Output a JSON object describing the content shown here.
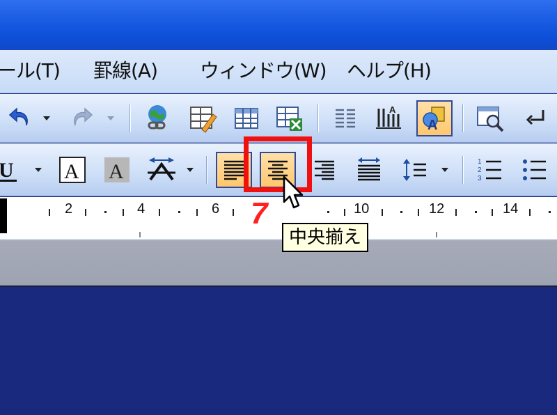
{
  "menubar": {
    "items": [
      {
        "label": "ール(T)"
      },
      {
        "label": "罫線(A)"
      },
      {
        "label": "ウィンドウ(W)"
      },
      {
        "label": "ヘルプ(H)"
      }
    ]
  },
  "toolbar": {
    "standard_icons": [
      "undo-icon",
      "redo-icon",
      "insert-hyperlink-icon",
      "tables-and-borders-icon",
      "insert-table-icon",
      "insert-excel-icon",
      "columns-icon",
      "drawing-icon",
      "document-map-icon",
      "show-hide-icon"
    ],
    "formatting_icons": [
      "underline-icon",
      "character-border-icon",
      "character-shading-icon",
      "phonetic-guide-icon",
      "align-left-icon",
      "align-center-icon",
      "align-right-icon",
      "distributed-icon",
      "line-spacing-icon",
      "numbering-icon",
      "bullets-icon"
    ],
    "pressed_color": "#ffc76d",
    "highlight_color": "#f01010"
  },
  "ruler": {
    "labels": [
      "2",
      "4",
      "6",
      "10",
      "12",
      "14"
    ]
  },
  "annotation": {
    "step_number": "7"
  },
  "tooltip": {
    "text": "中央揃え"
  }
}
